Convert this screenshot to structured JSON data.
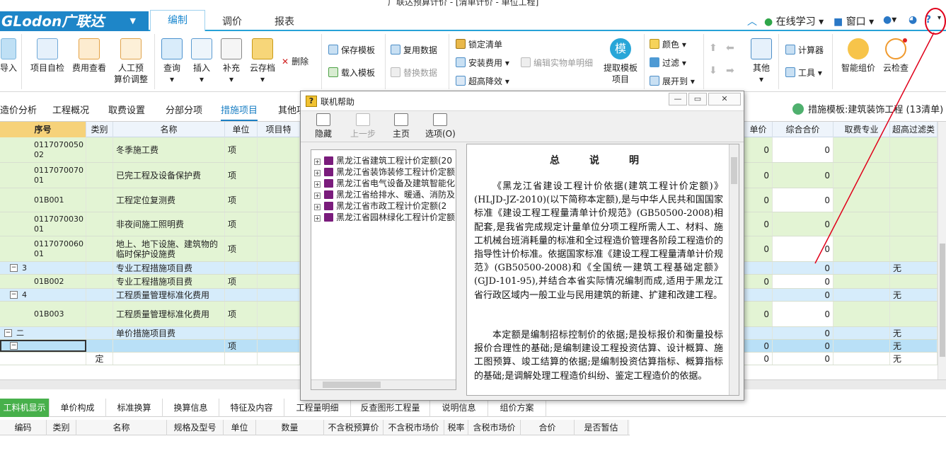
{
  "window": {
    "title": "广联达预算计价 - [清单计价 - 单位工程]"
  },
  "brand": {
    "logo": "GLodon广联达",
    "dropdown": "▼"
  },
  "menu_tabs": [
    "编制",
    "调价",
    "报表"
  ],
  "header_right": {
    "online": "在线学习",
    "window": "窗口"
  },
  "ribbon": {
    "import": "导入",
    "self_check": "项目自检",
    "fee_check": "费用查看",
    "manual_adjust_1": "人工预",
    "manual_adjust_2": "算价调整",
    "query": "查询",
    "insert": "插入",
    "supplement": "补充",
    "save_as": "云存档",
    "delete": "删除",
    "save_template": "保存模板",
    "load_template": "载入模板",
    "reuse_data": "复用数据",
    "replace_data": "替换数据",
    "lock_list": "锁定清单",
    "install_fee": "安装费用",
    "super_high": "超高降效",
    "edit_entity": "编辑实物单明细",
    "extract_template_1": "提取模板",
    "extract_template_2": "项目",
    "color": "颜色",
    "filter": "过滤",
    "expand_to": "展开到",
    "other": "其他",
    "calculator": "计算器",
    "tools": "工具",
    "smart_price": "智能组价",
    "cloud_check": "云检查",
    "template_badge": "模"
  },
  "subtabs": [
    "造价分析",
    "工程概况",
    "取费设置",
    "分部分项",
    "措施项目",
    "其他项"
  ],
  "template_info": "措施模板:建筑装饰工程 (13清单)",
  "grid": {
    "headers": [
      "序号",
      "类别",
      "名称",
      "单位",
      "项目特",
      "单价",
      "综合合价",
      "取费专业",
      "超高过滤类"
    ],
    "rows": [
      {
        "code": "011707005002",
        "cat": "",
        "name": "冬季施工费",
        "unit": "项",
        "price": "0",
        "total": "0",
        "filter": ""
      },
      {
        "code": "011707007001",
        "cat": "",
        "name": "已完工程及设备保护费",
        "unit": "项",
        "price": "0",
        "total": "0",
        "filter": ""
      },
      {
        "code": "01B001",
        "cat": "",
        "name": "工程定位复测费",
        "unit": "项",
        "price": "0",
        "total": "0",
        "filter": ""
      },
      {
        "code": "011707003001",
        "cat": "",
        "name": "非夜间施工照明费",
        "unit": "项",
        "price": "0",
        "total": "0",
        "filter": ""
      },
      {
        "code": "011707006001",
        "cat": "",
        "name": "地上、地下设施、建筑物的临时保护设施费",
        "unit": "项",
        "price": "0",
        "total": "0",
        "filter": ""
      },
      {
        "code": "3",
        "cat": "",
        "name": "专业工程措施项目费",
        "unit": "",
        "price": "",
        "total": "0",
        "filter": "无"
      },
      {
        "code": "01B002",
        "cat": "",
        "name": "专业工程措施项目费",
        "unit": "项",
        "price": "0",
        "total": "0",
        "filter": ""
      },
      {
        "code": "4",
        "cat": "",
        "name": "工程质量管理标准化费用",
        "unit": "",
        "price": "",
        "total": "0",
        "filter": "无"
      },
      {
        "code": "01B003",
        "cat": "",
        "name": "工程质量管理标准化费用",
        "unit": "项",
        "price": "0",
        "total": "0",
        "filter": ""
      },
      {
        "code": "二",
        "cat": "",
        "name": "单价措施项目费",
        "unit": "",
        "price": "",
        "total": "0",
        "filter": "无"
      },
      {
        "code": "",
        "cat": "",
        "name": "",
        "unit": "项",
        "price": "0",
        "total": "0",
        "filter": "无"
      },
      {
        "code": "",
        "cat": "定",
        "name": "",
        "unit": "",
        "price": "0",
        "total": "0",
        "filter": "无"
      }
    ]
  },
  "bottom_tabs": [
    "工料机显示",
    "单价构成",
    "标准换算",
    "换算信息",
    "特征及内容",
    "工程量明细",
    "反查图形工程量",
    "说明信息",
    "组价方案"
  ],
  "bottom_headers": [
    "编码",
    "类别",
    "名称",
    "规格及型号",
    "单位",
    "数量",
    "不含税预算价",
    "不含税市场价",
    "税率",
    "含税市场价",
    "合价",
    "是否暂估"
  ],
  "dialog": {
    "title": "联机帮助",
    "toolbar": {
      "hide": "隐藏",
      "back": "上一步",
      "home": "主页",
      "options": "选项(O)"
    },
    "tree": [
      "黑龙江省建筑工程计价定额(20",
      "黑龙江省装饰装修工程计价定额",
      "黑龙江省电气设备及建筑智能化",
      "黑龙江省给排水、暖通、消防及",
      "黑龙江省市政工程计价定额(2",
      "黑龙江省园林绿化工程计价定额"
    ],
    "heading": "总说明",
    "paragraph1": "《黑龙江省建设工程计价依据(建筑工程计价定额)》(HLJD-JZ-2010)(以下简称本定额),是与中华人民共和国国家标准《建设工程工程量清单计价规范》(GB50500-2008)相配套,是我省完成规定计量单位分项工程所需人工、材料、施工机械台班消耗量的标准和全过程造价管理各阶段工程造价的指导性计价标准。依据国家标准《建设工程工程量清单计价规范》(GB50500-2008)和《全国统一建筑工程基础定额》(GJD-101-95),并结合本省实际情况编制而成,适用于黑龙江省行政区域内一般工业与民用建筑的新建、扩建和改建工程。",
    "paragraph2": "本定额是编制招标控制价的依据;是投标报价和衡量投标报价合理性的基础;是编制建设工程投资估算、设计概算、施工图预算、竣工结算的依据;是编制投资估算指标、概算指标的基础;是调解处理工程造价纠纷、鉴定工程造价的依据。"
  },
  "colors": {
    "accent": "#1f8ad0",
    "row_green": "#e3f4d4",
    "row_blue": "#d6ecfb",
    "row_selected": "#b9e0f7",
    "tab_green": "#47b04b",
    "annotation": "#e0001a"
  }
}
